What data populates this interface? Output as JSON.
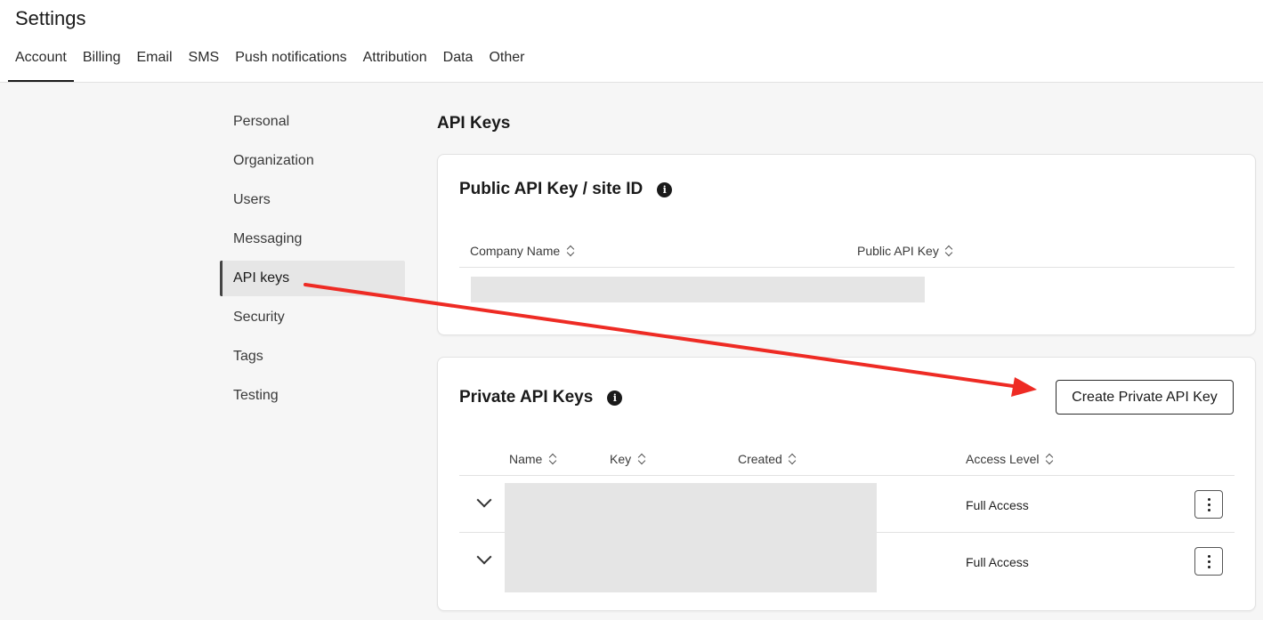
{
  "header": {
    "title": "Settings",
    "tabs": [
      {
        "label": "Account",
        "active": true
      },
      {
        "label": "Billing"
      },
      {
        "label": "Email"
      },
      {
        "label": "SMS"
      },
      {
        "label": "Push notifications"
      },
      {
        "label": "Attribution"
      },
      {
        "label": "Data"
      },
      {
        "label": "Other"
      }
    ]
  },
  "sidebar": {
    "items": [
      {
        "label": "Personal"
      },
      {
        "label": "Organization"
      },
      {
        "label": "Users"
      },
      {
        "label": "Messaging"
      },
      {
        "label": "API keys",
        "active": true
      },
      {
        "label": "Security"
      },
      {
        "label": "Tags"
      },
      {
        "label": "Testing"
      }
    ]
  },
  "main": {
    "title": "API Keys",
    "public_card": {
      "title": "Public API Key / site ID",
      "info_icon": "info-icon",
      "columns": [
        "Company Name",
        "Public API Key"
      ]
    },
    "private_card": {
      "title": "Private API Keys",
      "info_icon": "info-icon",
      "create_button": "Create Private API Key",
      "columns": [
        "Name",
        "Key",
        "Created",
        "Access Level"
      ],
      "rows": [
        {
          "access_level": "Full Access"
        },
        {
          "access_level": "Full Access"
        }
      ]
    }
  },
  "annotation": {
    "arrow_color": "#ee2b24"
  },
  "colors": {
    "accent": "#1a1a1a",
    "redacted": "#e5e5e5"
  }
}
